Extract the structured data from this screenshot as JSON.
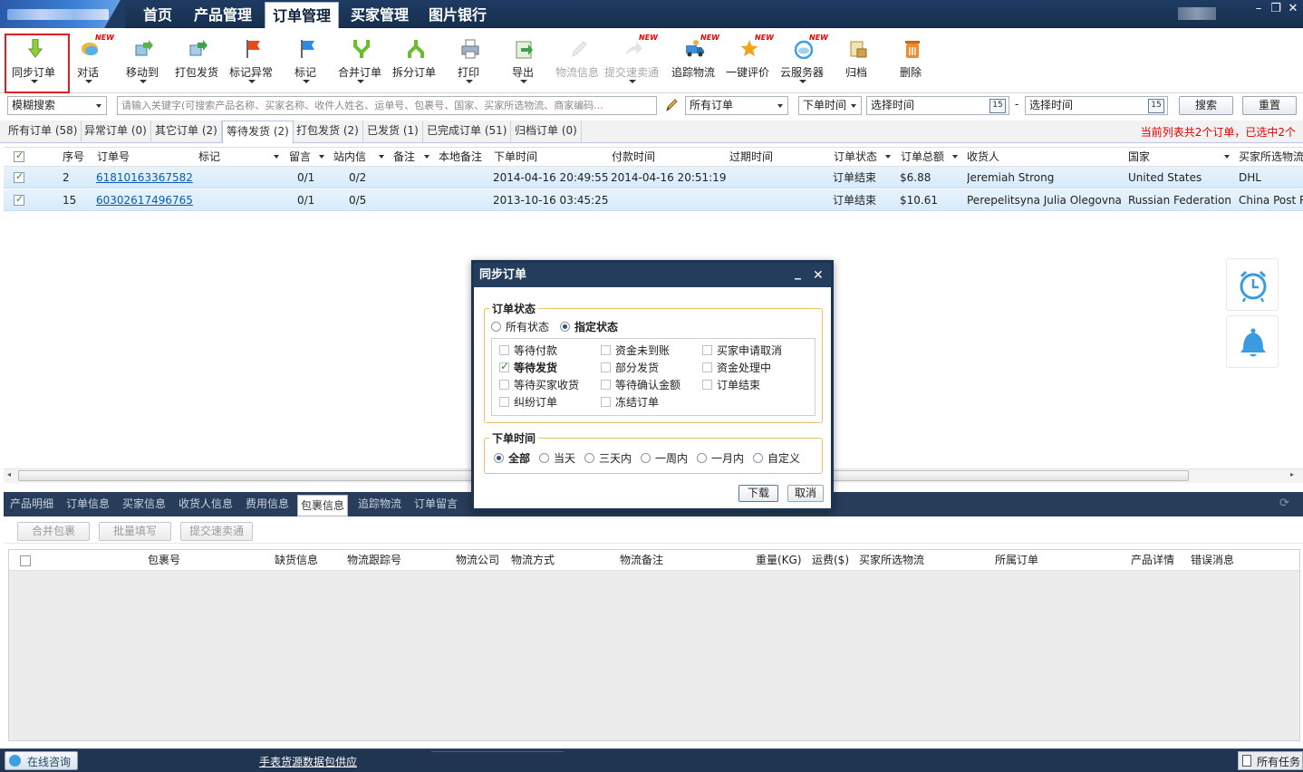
{
  "nav": {
    "tabs": [
      "首页",
      "产品管理",
      "订单管理",
      "买家管理",
      "图片银行"
    ],
    "active": 2,
    "window_controls": [
      "–",
      "❐",
      "✕"
    ]
  },
  "toolbar": {
    "buttons": [
      {
        "label": "同步订单",
        "icon": "sync-down-arrow-icon",
        "dropdown": true,
        "new": false,
        "disabled": false
      },
      {
        "label": "对话",
        "icon": "chat-bubble-icon",
        "dropdown": true,
        "new": true,
        "disabled": false
      },
      {
        "label": "移动到",
        "icon": "move-to-icon",
        "dropdown": true,
        "new": false,
        "disabled": false
      },
      {
        "label": "打包发货",
        "icon": "package-ship-icon",
        "dropdown": false,
        "new": false,
        "disabled": false
      },
      {
        "label": "标记异常",
        "icon": "red-flag-icon",
        "dropdown": true,
        "new": false,
        "disabled": false
      },
      {
        "label": "标记",
        "icon": "blue-flag-icon",
        "dropdown": true,
        "new": false,
        "disabled": false
      },
      {
        "label": "合并订单",
        "icon": "merge-icon",
        "dropdown": true,
        "new": false,
        "disabled": false
      },
      {
        "label": "拆分订单",
        "icon": "split-icon",
        "dropdown": false,
        "new": false,
        "disabled": false
      },
      {
        "label": "打印",
        "icon": "printer-icon",
        "dropdown": true,
        "new": false,
        "disabled": false
      },
      {
        "label": "导出",
        "icon": "export-icon",
        "dropdown": true,
        "new": false,
        "disabled": false
      },
      {
        "label": "物流信息",
        "icon": "logistics-pencil-icon",
        "dropdown": false,
        "new": false,
        "disabled": true
      },
      {
        "label": "提交速卖通",
        "icon": "submit-arrow-icon",
        "dropdown": true,
        "new": true,
        "disabled": true
      },
      {
        "label": "追踪物流",
        "icon": "tracking-truck-icon",
        "dropdown": false,
        "new": true,
        "disabled": false
      },
      {
        "label": "一键评价",
        "icon": "star-icon",
        "dropdown": false,
        "new": true,
        "disabled": false
      },
      {
        "label": "云服务器",
        "icon": "cloud-icon",
        "dropdown": true,
        "new": true,
        "disabled": false
      },
      {
        "label": "归档",
        "icon": "archive-icon",
        "dropdown": false,
        "new": false,
        "disabled": false
      },
      {
        "label": "删除",
        "icon": "trash-icon",
        "dropdown": false,
        "new": false,
        "disabled": false
      }
    ],
    "new_badge": "NEW"
  },
  "search": {
    "mode": "模糊搜索",
    "placeholder": "请输入关键字(可搜索产品名称、买家名称、收件人姓名、运单号、包裹号、国家、买家所选物流、商家编码...",
    "order_filter": "所有订单",
    "time_field": "下单时间",
    "start_placeholder": "选择时间",
    "dash": "-",
    "end_placeholder": "选择时间",
    "calendar_day": "15",
    "search_button": "搜索",
    "reset_button": "重置"
  },
  "order_tabs": [
    "所有订单 (58)",
    "异常订单 (0)",
    "其它订单 (2)",
    "等待发货 (2)",
    "打包发货 (2)",
    "已发货 (1)",
    "已完成订单 (51)",
    "归档订单 (0)"
  ],
  "order_tabs_active": 3,
  "count_info": "当前列表共2个订单，已选中2个",
  "grid": {
    "columns": [
      "序号",
      "订单号",
      "标记",
      "留言",
      "站内信",
      "备注",
      "本地备注",
      "下单时间",
      "付款时间",
      "过期时间",
      "订单状态",
      "订单总额",
      "收货人",
      "国家",
      "买家所选物流"
    ],
    "rows": [
      {
        "seq": "2",
        "order_no": "61810163367582",
        "msg": "0/1",
        "inbox": "0/2",
        "order_time": "2014-04-16 20:49:55",
        "pay_time": "2014-04-16 20:51:19",
        "status": "订单结束",
        "total": "$6.88",
        "receiver": "Jeremiah Strong",
        "country": "United States",
        "logistics": "DHL"
      },
      {
        "seq": "15",
        "order_no": "60302617496765",
        "msg": "0/1",
        "inbox": "0/5",
        "order_time": "2013-10-16 03:45:25",
        "pay_time": "",
        "status": "订单结束",
        "total": "$10.61",
        "receiver": "Perepelitsyna Julia Olegovna",
        "country": "Russian Federation",
        "logistics": "China Post R"
      }
    ]
  },
  "bottom": {
    "tabs": [
      "产品明细",
      "订单信息",
      "买家信息",
      "收货人信息",
      "费用信息",
      "包裹信息",
      "追踪物流",
      "订单留言"
    ],
    "active": 5,
    "buttons": [
      "合并包裹",
      "批量填写",
      "提交速卖通"
    ],
    "columns": [
      "包裹号",
      "缺货信息",
      "物流跟踪号",
      "物流公司",
      "物流方式",
      "物流备注",
      "重量(KG)",
      "运费($)",
      "买家所选物流",
      "所属订单",
      "产品详情",
      "错误消息"
    ]
  },
  "status": {
    "online_consult": "在线咨询",
    "ad_link": "手表货源数据包供应",
    "tasks": "所有任务"
  },
  "dialog": {
    "title": "同步订单",
    "minimize": "_",
    "close": "✕",
    "status_legend": "订单状态",
    "status_all": "所有状态",
    "status_specified": "指定状态",
    "status_options": [
      {
        "label": "等待付款",
        "checked": false
      },
      {
        "label": "资金未到账",
        "checked": false
      },
      {
        "label": "买家申请取消",
        "checked": false
      },
      {
        "label": "等待发货",
        "checked": true
      },
      {
        "label": "部分发货",
        "checked": false
      },
      {
        "label": "资金处理中",
        "checked": false
      },
      {
        "label": "等待买家收货",
        "checked": false
      },
      {
        "label": "等待确认金额",
        "checked": false
      },
      {
        "label": "订单结束",
        "checked": false
      },
      {
        "label": "纠纷订单",
        "checked": false
      },
      {
        "label": "冻结订单",
        "checked": false
      }
    ],
    "time_legend": "下单时间",
    "time_options": [
      "全部",
      "当天",
      "三天内",
      "一周内",
      "一月内",
      "自定义"
    ],
    "time_selected": 0,
    "download_button": "下载",
    "cancel_button": "取消"
  },
  "colors": {
    "nav_bg": "#1f3b63",
    "highlight_red": "#e02020",
    "row_selected": "#d7ebfb",
    "link": "#0b5cad",
    "count_info": "#e00000",
    "dialog_border": "#1b3453",
    "fieldset_border": "#e8c070"
  }
}
